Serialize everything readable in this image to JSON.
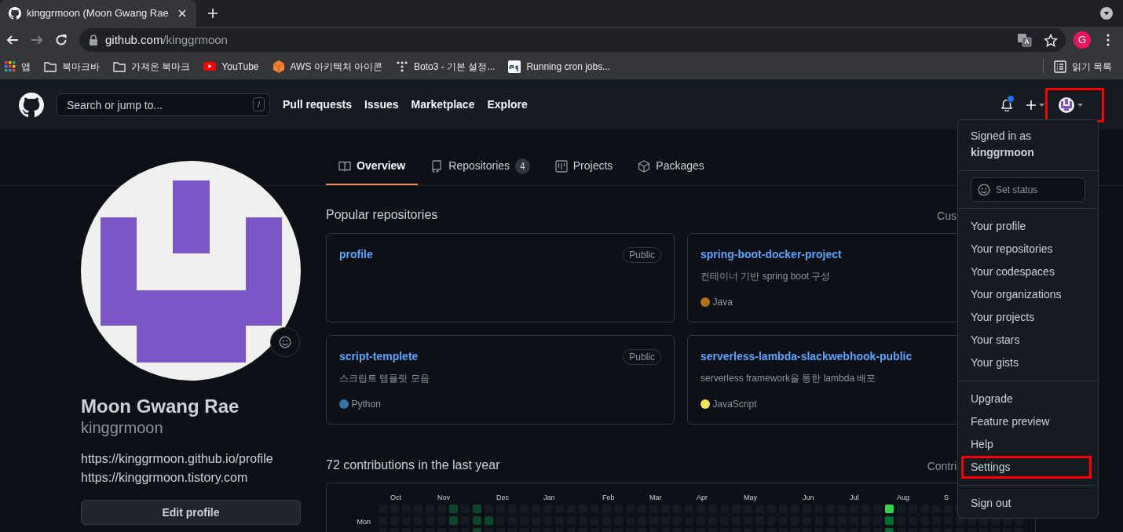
{
  "browser": {
    "tab": {
      "title": "kinggrmoon (Moon Gwang Rae"
    },
    "nav_buttons": [
      {
        "kind": "back",
        "disabled": false
      },
      {
        "kind": "forward",
        "disabled": true
      },
      {
        "kind": "reload",
        "disabled": false
      }
    ],
    "address": {
      "host": "github.com",
      "path": "/kinggrmoon"
    },
    "profile_initial": "G",
    "bookmarks": [
      {
        "kind": "apps",
        "label": "앱"
      },
      {
        "kind": "folder",
        "label": "북마크바"
      },
      {
        "kind": "folder",
        "label": "가져온 북마크"
      },
      {
        "kind": "youtube",
        "label": "YouTube"
      },
      {
        "kind": "aws",
        "label": "AWS 아키텍처 아이콘"
      },
      {
        "kind": "dots",
        "label": "Boto3 - 기본 설정..."
      },
      {
        "kind": "eq",
        "label": "Running cron jobs..."
      }
    ],
    "reading_list": "읽기 목록"
  },
  "header": {
    "search": {
      "placeholder": "Search or jump to...",
      "shortcut": "/"
    },
    "nav": [
      "Pull requests",
      "Issues",
      "Marketplace",
      "Explore"
    ],
    "notifications_unread": true,
    "avatar_menu_highlighted": true
  },
  "profile_tabs": [
    {
      "kind": "overview",
      "label": "Overview",
      "selected": true
    },
    {
      "kind": "repositories",
      "label": "Repositories",
      "count": "4",
      "selected": false
    },
    {
      "kind": "projects",
      "label": "Projects",
      "selected": false
    },
    {
      "kind": "packages",
      "label": "Packages",
      "selected": false
    }
  ],
  "profile": {
    "name": "Moon Gwang Rae",
    "username": "kinggrmoon",
    "links": [
      "https://kinggrmoon.github.io/profile",
      "https://kinggrmoon.tistory.com"
    ],
    "edit_button": "Edit profile"
  },
  "popular": {
    "title": "Popular repositories",
    "side_link": "Cus",
    "repos": [
      {
        "name": "profile",
        "visibility": "Public"
      },
      {
        "name": "spring-boot-docker-project",
        "description": "컨테이너 기반 spring boot 구성",
        "language": "Java",
        "color": "#b07219"
      },
      {
        "name": "script-templete",
        "visibility": "Public",
        "description": "스크립트 템플릿 모음",
        "language": "Python",
        "color": "#3572a5"
      },
      {
        "name": "serverless-lambda-slackwebhook-public",
        "description": "serverless framework을 통한 lambda 배포",
        "language": "JavaScript",
        "color": "#f1e05a"
      }
    ]
  },
  "contributions": {
    "title": "72 contributions in the last year",
    "side_link": "Contri",
    "months": [
      "Oct",
      "Nov",
      "Dec",
      "Jan",
      "Feb",
      "Mar",
      "Apr",
      "May",
      "Jun",
      "Jul",
      "Aug",
      "S"
    ],
    "day_labels": [
      "Mon"
    ]
  },
  "user_menu": {
    "signed_in_label": "Signed in as",
    "username": "kinggrmoon",
    "status_button": "Set status",
    "groups": [
      [
        {
          "label": "Your profile",
          "highlighted": false
        },
        {
          "label": "Your repositories",
          "highlighted": false
        },
        {
          "label": "Your codespaces",
          "highlighted": false
        },
        {
          "label": "Your organizations",
          "highlighted": false
        },
        {
          "label": "Your projects",
          "highlighted": false
        },
        {
          "label": "Your stars",
          "highlighted": false
        },
        {
          "label": "Your gists",
          "highlighted": false
        }
      ],
      [
        {
          "label": "Upgrade",
          "highlighted": false
        },
        {
          "label": "Feature preview",
          "highlighted": false
        },
        {
          "label": "Help",
          "highlighted": false
        },
        {
          "label": "Settings",
          "highlighted": true
        }
      ],
      [
        {
          "label": "Sign out",
          "highlighted": false
        }
      ]
    ]
  }
}
